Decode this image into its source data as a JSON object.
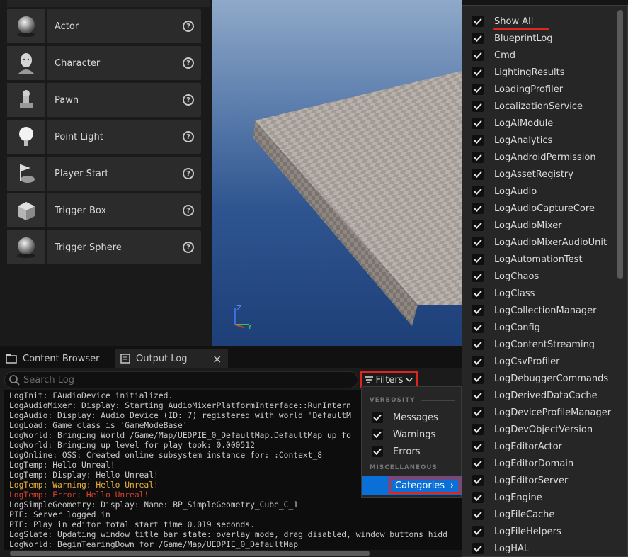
{
  "place_actors": {
    "items": [
      {
        "label": "Actor",
        "icon": "sphere-icon"
      },
      {
        "label": "Character",
        "icon": "character-icon"
      },
      {
        "label": "Pawn",
        "icon": "pawn-icon"
      },
      {
        "label": "Point Light",
        "icon": "lightbulb-icon"
      },
      {
        "label": "Player Start",
        "icon": "flag-icon"
      },
      {
        "label": "Trigger Box",
        "icon": "cube-icon"
      },
      {
        "label": "Trigger Sphere",
        "icon": "sphere-icon"
      }
    ],
    "help_glyph": "?"
  },
  "viewport": {
    "axis": {
      "z": "Z",
      "y": "Y"
    }
  },
  "dock": {
    "tabs": [
      {
        "label": "Content Browser",
        "icon": "content-browser-icon"
      },
      {
        "label": "Output Log",
        "icon": "output-log-icon",
        "active": true
      }
    ],
    "close_glyph": "×"
  },
  "output_log": {
    "search_placeholder": "Search Log",
    "filters_label": "Filters",
    "lines": [
      {
        "text": "LogInit: FAudioDevice initialized.",
        "level": "normal"
      },
      {
        "text": "LogAudioMixer: Display: Starting AudioMixerPlatformInterface::RunIntern",
        "level": "normal"
      },
      {
        "text": "LogAudio: Display: Audio Device (ID: 7) registered with world 'DefaultM",
        "level": "normal"
      },
      {
        "text": "LogLoad: Game class is 'GameModeBase'",
        "level": "normal"
      },
      {
        "text": "LogWorld: Bringing World /Game/Map/UEDPIE_0_DefaultMap.DefaultMap up fo",
        "level": "normal"
      },
      {
        "text": "LogWorld: Bringing up level for play took: 0.000512",
        "level": "normal"
      },
      {
        "text": "LogOnline: OSS: Created online subsystem instance for: :Context_8",
        "level": "normal"
      },
      {
        "text": "LogTemp: Hello Unreal!",
        "level": "normal"
      },
      {
        "text": "LogTemp: Display: Hello Unreal!",
        "level": "normal"
      },
      {
        "text": "LogTemp: Warning: Hello Unreal!",
        "level": "warn"
      },
      {
        "text": "LogTemp: Error: Hello Unreal!",
        "level": "err"
      },
      {
        "text": "LogSimpleGeometry: Display: Name: BP_SimpleGeometry_Cube_C_1",
        "level": "normal"
      },
      {
        "text": "PIE: Server logged in",
        "level": "normal"
      },
      {
        "text": "PIE: Play in editor total start time 0.019 seconds.",
        "level": "normal"
      },
      {
        "text": "LogSlate: Updating window title bar state: overlay mode, drag disabled, window buttons hidd",
        "level": "normal"
      },
      {
        "text": "LogWorld: BeginTearingDown for /Game/Map/UEDPIE_0_DefaultMap",
        "level": "normal"
      }
    ]
  },
  "filter_menu": {
    "verbosity_header": "VERBOSITY",
    "verbosity": [
      {
        "label": "Messages",
        "checked": true
      },
      {
        "label": "Warnings",
        "checked": true
      },
      {
        "label": "Errors",
        "checked": true
      }
    ],
    "misc_header": "MISCELLANEOUS",
    "categories_label": "Categories",
    "chevron": "›"
  },
  "categories": [
    "Show All",
    "BlueprintLog",
    "Cmd",
    "LightingResults",
    "LoadingProfiler",
    "LocalizationService",
    "LogAIModule",
    "LogAnalytics",
    "LogAndroidPermission",
    "LogAssetRegistry",
    "LogAudio",
    "LogAudioCaptureCore",
    "LogAudioMixer",
    "LogAudioMixerAudioUnit",
    "LogAutomationTest",
    "LogChaos",
    "LogClass",
    "LogCollectionManager",
    "LogConfig",
    "LogContentStreaming",
    "LogCsvProfiler",
    "LogDebuggerCommands",
    "LogDerivedDataCache",
    "LogDeviceProfileManager",
    "LogDevObjectVersion",
    "LogEditorActor",
    "LogEditorDomain",
    "LogEditorServer",
    "LogEngine",
    "LogFileCache",
    "LogFileHelpers",
    "LogHAL"
  ],
  "colors": {
    "highlight_red": "#e0241e",
    "selection_blue": "#0a6fd6",
    "warning": "#e8b13a",
    "error": "#d9412e"
  }
}
